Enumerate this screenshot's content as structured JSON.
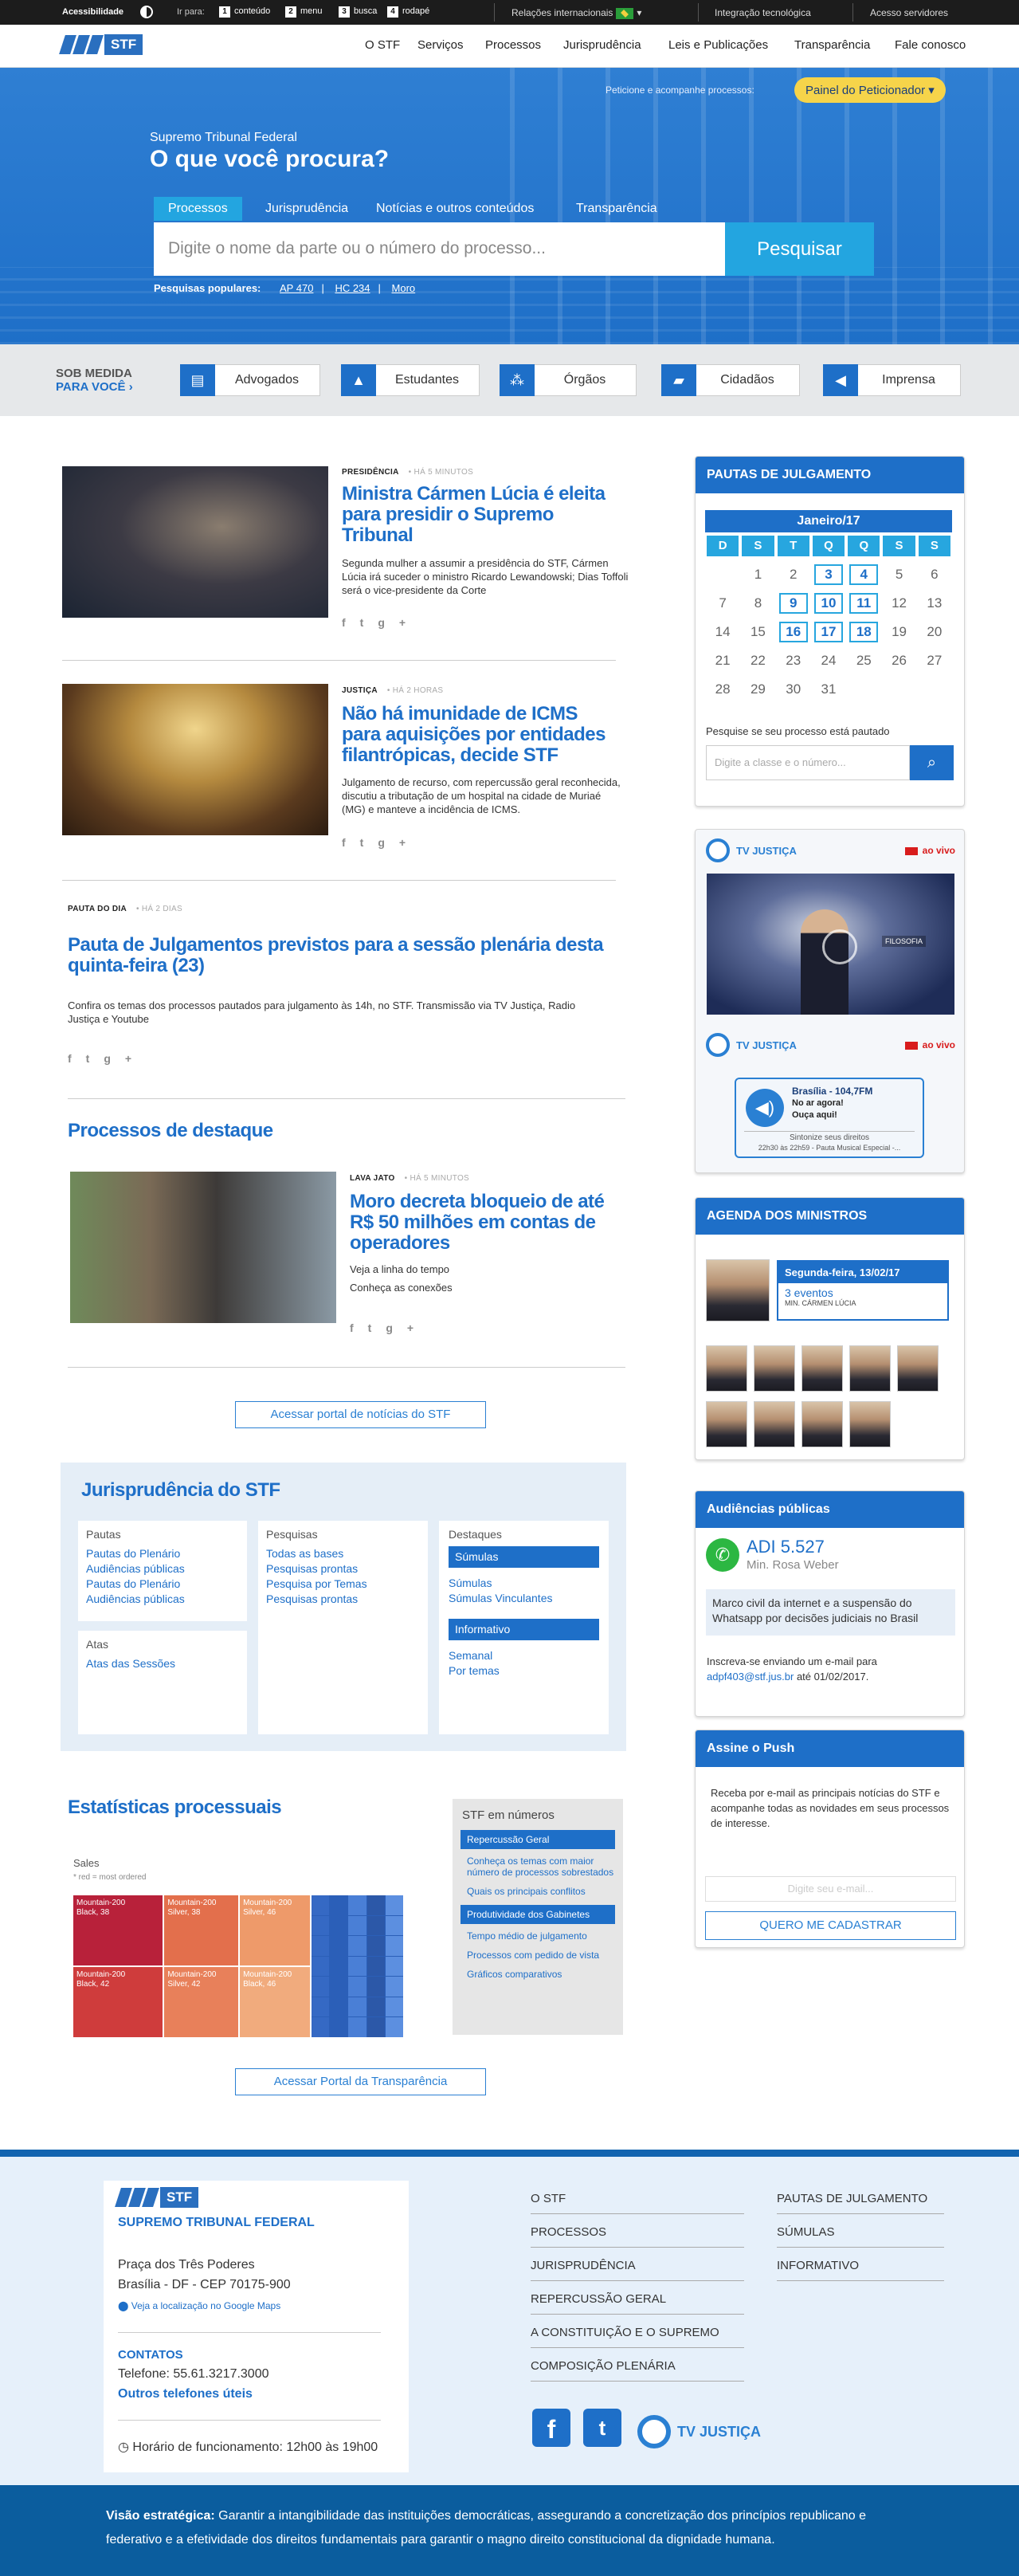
{
  "topbar": {
    "accessibility": "Acessibilidade",
    "go_to": "Ir para:",
    "skip": [
      {
        "key": "1",
        "label": "conteúdo"
      },
      {
        "key": "2",
        "label": "menu"
      },
      {
        "key": "3",
        "label": "busca"
      },
      {
        "key": "4",
        "label": "rodapé"
      }
    ],
    "international": "Relações internacionais",
    "tech": "Integração tecnológica",
    "servers": "Acesso servidores"
  },
  "nav": {
    "logo": "STF",
    "items": [
      "O STF",
      "Serviços",
      "Processos",
      "Jurisprudência",
      "Leis e Publicações",
      "Transparência",
      "Fale conosco"
    ]
  },
  "hero": {
    "petition_text": "Peticione e acompanhe processos:",
    "petition_button": "Painel do Peticionador",
    "subtitle": "Supremo Tribunal Federal",
    "title": "O que você procura?",
    "tabs": [
      "Processos",
      "Jurisprudência",
      "Notícias e outros conteúdos",
      "Transparência"
    ],
    "search_placeholder": "Digite o nome da parte ou o número do processo...",
    "search_button": "Pesquisar",
    "popular_label": "Pesquisas populares:",
    "popular": [
      "AP 470",
      "HC 234",
      "Moro"
    ]
  },
  "sob_medida": {
    "label1": "SOB MEDIDA",
    "label2": "PARA VOCÊ",
    "buttons": [
      "Advogados",
      "Estudantes",
      "Órgãos",
      "Cidadãos",
      "Imprensa"
    ]
  },
  "news": [
    {
      "category": "PRESIDÊNCIA",
      "time": "HÁ 5 MINUTOS",
      "title": "Ministra Cármen Lúcia é eleita para presidir o Supremo Tribunal",
      "summary": "Segunda mulher a assumir a presidência do STF, Cármen Lúcia irá suceder o ministro Ricardo Lewandowski; Dias Toffoli será o vice-presidente da Corte"
    },
    {
      "category": "JUSTIÇA",
      "time": "HÁ 2 HORAS",
      "title": "Não há imunidade de ICMS para aquisições por entidades filantrópicas, decide STF",
      "summary": "Julgamento de recurso, com repercussão geral reconhecida, discutiu a tributação de um hospital na cidade de Muriaé (MG) e manteve a incidência de ICMS."
    },
    {
      "category": "PAUTA DO DIA",
      "time": "HÁ 2 DIAS",
      "title": "Pauta de Julgamentos previstos para a sessão plenária desta quinta-feira (23)",
      "summary": "Confira os temas dos processos pautados para julgamento às 14h, no STF. Transmissão via TV Justiça, Radio Justiça e Youtube"
    }
  ],
  "featured": {
    "section_title": "Processos de destaque",
    "category": "LAVA JATO",
    "time": "HÁ 5 MINUTOS",
    "title": "Moro decreta bloqueio de até R$ 50 milhões em contas de operadores",
    "line1": "Veja a linha do tempo",
    "line2": "Conheça as conexões",
    "portal_button": "Acessar portal de notícias do STF"
  },
  "juris": {
    "title": "Jurisprudência do STF",
    "pautas": {
      "header": "Pautas",
      "items": [
        "Pautas do Plenário",
        "Audiências públicas",
        "Pautas do Plenário",
        "Audiências públicas"
      ]
    },
    "atas": {
      "header": "Atas",
      "items": [
        "Atas das Sessões"
      ]
    },
    "pesquisas": {
      "header": "Pesquisas",
      "items": [
        "Todas as bases",
        "Pesquisas prontas",
        "Pesquisa por Temas",
        "Pesquisas prontas"
      ]
    },
    "destaques": {
      "header": "Destaques",
      "bar1": "Súmulas",
      "items1": [
        "Súmulas",
        "Súmulas Vinculantes"
      ],
      "bar2": "Informativo",
      "items2": [
        "Semanal",
        "Por temas"
      ]
    }
  },
  "stats": {
    "title": "Estatísticas processuais",
    "box_title": "STF em números",
    "bar1": "Repercussão Geral",
    "links1": [
      "Conheça os temas com maior número de processos sobrestados",
      "Quais os principais conflitos"
    ],
    "bar2": "Produtividade dos Gabinetes",
    "links2": [
      "Tempo médio de julgamento",
      "Processos com pedido de vista",
      "Gráficos comparativos"
    ],
    "portal_button": "Acessar Portal da Transparência"
  },
  "treemap": {
    "title": "Sales",
    "subtitle": "* red = most ordered",
    "cells": [
      {
        "label": "Mountain-200\nBlack, 38",
        "color": "#b8213a"
      },
      {
        "label": "Mountain-200\nSilver, 38",
        "color": "#e36f4c"
      },
      {
        "label": "Mountain-200\nSilver, 46",
        "color": "#ee9a6a"
      },
      {
        "label": "Mountain-200\nBlack, 42",
        "color": "#cf3c3c"
      },
      {
        "label": "Mountain-200\nSilver, 42",
        "color": "#e8805a"
      },
      {
        "label": "Mountain-200\nBlack, 46",
        "color": "#f1ab7d"
      }
    ]
  },
  "calendar": {
    "title": "PAUTAS DE JULGAMENTO",
    "month": "Janeiro/17",
    "weekdays": [
      "D",
      "S",
      "T",
      "Q",
      "Q",
      "S",
      "S"
    ],
    "days": [
      "",
      "1",
      "2",
      "3",
      "4",
      "5",
      "6",
      "7",
      "8",
      "9",
      "10",
      "11",
      "12",
      "13",
      "14",
      "15",
      "16",
      "17",
      "18",
      "19",
      "20",
      "21",
      "22",
      "23",
      "24",
      "25",
      "26",
      "27",
      "28",
      "29",
      "30",
      "31"
    ],
    "highlighted": [
      "3",
      "4",
      "9",
      "10",
      "11",
      "16",
      "17",
      "18"
    ],
    "search_label": "Pesquise se seu processo está pautado",
    "search_placeholder": "Digite a classe e o número..."
  },
  "tv": {
    "brand": "TV JUSTIÇA",
    "live": "ao vivo",
    "screen_text": "FILOSOFIA",
    "radio_station": "Brasília - 104,7FM",
    "radio_line1": "No ar agora!",
    "radio_line2": "Ouça aqui!",
    "radio_program": "Sintonize seus direitos",
    "radio_time": "22h30 às 22h59 - Pauta Musical Especial -..."
  },
  "agenda": {
    "title": "AGENDA DOS MINISTROS",
    "date": "Segunda-feira, 13/02/17",
    "events": "3 eventos",
    "minister": "MIN. CÁRMEN LÚCIA"
  },
  "audiencias": {
    "title": "Audiências públicas",
    "adi": "ADI 5.527",
    "minister": "Min. Rosa Weber",
    "topic": "Marco civil da internet e a suspensão do Whatsapp por decisões judiciais no Brasil",
    "signup_text": "Inscreva-se enviando um e-mail para",
    "email": "adpf403@stf.jus.br",
    "deadline": "até 01/02/2017."
  },
  "push": {
    "title": "Assine o Push",
    "text": "Receba por e-mail as principais notícias do STF e acompanhe todas as novidades em seus processos de interesse.",
    "placeholder": "Digite seu e-mail...",
    "button": "QUERO ME CADASTRAR"
  },
  "footer": {
    "logo": "STF",
    "org": "SUPREMO TRIBUNAL FEDERAL",
    "address1": "Praça dos Três Poderes",
    "address2": "Brasília - DF - CEP 70175-900",
    "maps": "Veja a localização no Google Maps",
    "contacts": "CONTATOS",
    "phone": "Telefone: 55.61.3217.3000",
    "other_phones": "Outros telefones úteis",
    "hours": "Horário de funcionamento: 12h00 às 19h00",
    "links_col1": [
      "O STF",
      "PROCESSOS",
      "JURISPRUDÊNCIA",
      "REPERCUSSÃO GERAL",
      "A CONSTITUIÇÃO E O SUPREMO",
      "COMPOSIÇÃO PLENÁRIA"
    ],
    "links_col2": [
      "PAUTAS DE JULGAMENTO",
      "SÚMULAS",
      "INFORMATIVO"
    ],
    "tv_brand": "TV JUSTIÇA",
    "vision_label": "Visão estratégica:",
    "vision_text": "Garantir a intangibilidade das instituições democráticas, assegurando a concretização dos princípios republicano e federativo e a efetividade dos direitos fundamentais para garantir o magno direito constitucional da dignidade humana."
  }
}
